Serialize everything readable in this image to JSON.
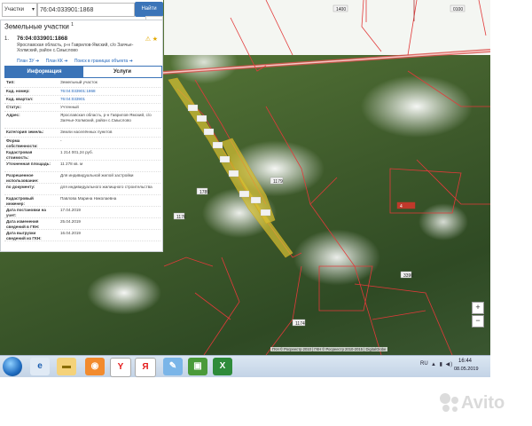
{
  "search": {
    "type_selected": "Участки",
    "query": "76:04:033901:1868",
    "find_label": "Найти"
  },
  "panel": {
    "title": "Земельные участки",
    "title_count": "1",
    "result": {
      "number": "1.",
      "cadastral": "76:04:033901:1868",
      "address": "Ярославская область, р-н Гаврилов-Ямский, с/о Заячье-Холмский, район с.Смыслово",
      "links": [
        "План ЗУ ➔",
        "План КК ➔",
        "Поиск в границах объекта ➔"
      ]
    },
    "tabs": [
      "Информация",
      "Услуги"
    ],
    "attributes": [
      {
        "label": "Тип:",
        "value": "Земельный участок"
      },
      {
        "label": "Кад. номер:",
        "value": "76:04:033901:1868"
      },
      {
        "label": "Кад. квартал:",
        "value": "76:04:033901"
      },
      {
        "label": "Статус:",
        "value": "Учтенный"
      },
      {
        "label": "Адрес:",
        "value": "Ярославская область, р-н Гаврилов-Ямский, с/о Заячье-Холмский, район с.Смыслово"
      },
      {
        "label": "Категория земель:",
        "value": "Земли населённых пунктов"
      },
      {
        "label": "Форма собственности:",
        "value": "-"
      },
      {
        "label": "Кадастровая стоимость:",
        "value": "1 214 001,24 руб."
      },
      {
        "label": "Уточненная площадь:",
        "value": "11 278 кв. м"
      },
      {
        "label": "Разрешенное использование:",
        "value": "Для индивидуальной жилой застройки"
      },
      {
        "label": "по документу:",
        "value": "для индивидуального жилищного строительства"
      },
      {
        "label": "Кадастровый инженер:",
        "value": "Павлова Марина Николаевна"
      },
      {
        "label": "Дата постановки на учет:",
        "value": "17.04.2019"
      },
      {
        "label": "Дата изменения сведений в ГКН:",
        "value": "25.04.2019"
      },
      {
        "label": "Дата выгрузки сведений из ГКН:",
        "value": "16.04.2019"
      }
    ]
  },
  "map": {
    "zoom_in": "+",
    "zoom_out": "−",
    "credits": "ГКН © Росреестр 2010 | ГКН © Росреестр 2010-2015 | DigitalGlobe",
    "parcel_labels": [
      "1400",
      "0100",
      "1179",
      "1789",
      "1176",
      "1174",
      "3390",
      "4"
    ]
  },
  "taskbar": {
    "lang": "RU",
    "time": "16:44",
    "date": "08.05.2019"
  },
  "watermark": "Avito",
  "colors": {
    "accent": "#3b74b8",
    "parcel_highlight": "#d9c233",
    "boundary": "#e23a3a"
  }
}
